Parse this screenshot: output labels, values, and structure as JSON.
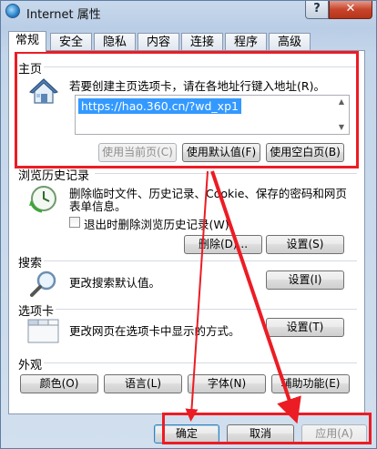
{
  "window": {
    "title": "Internet 属性",
    "help_label": "?",
    "close_label": "✕"
  },
  "tabs": [
    {
      "label": "常规",
      "active": true
    },
    {
      "label": "安全"
    },
    {
      "label": "隐私"
    },
    {
      "label": "内容"
    },
    {
      "label": "连接"
    },
    {
      "label": "程序"
    },
    {
      "label": "高级"
    }
  ],
  "homepage": {
    "group_label": "主页",
    "description": "若要创建主页选项卡，请在各地址行键入地址(R)。",
    "url_value": "https://hao.360.cn/?wd_xp1",
    "use_current_label": "使用当前页(C)",
    "use_default_label": "使用默认值(F)",
    "use_blank_label": "使用空白页(B)"
  },
  "history": {
    "group_label": "浏览历史记录",
    "description_line1": "删除临时文件、历史记录、Cookie、保存的密码和网页",
    "description_line2": "表单信息。",
    "checkbox_label": "退出时删除浏览历史记录(W)",
    "delete_label": "删除(D)...",
    "settings_label": "设置(S)"
  },
  "search": {
    "group_label": "搜索",
    "description": "更改搜索默认值。",
    "settings_label": "设置(I)"
  },
  "tabs_group": {
    "group_label": "选项卡",
    "description": "更改网页在选项卡中显示的方式。",
    "settings_label": "设置(T)"
  },
  "appearance": {
    "group_label": "外观",
    "colors_label": "颜色(O)",
    "languages_label": "语言(L)",
    "fonts_label": "字体(N)",
    "accessibility_label": "辅助功能(E)"
  },
  "footer": {
    "ok_label": "确定",
    "cancel_label": "取消",
    "apply_label": "应用(A)"
  },
  "colors": {
    "highlight": "#ec1c24",
    "selection": "#3399ff"
  }
}
